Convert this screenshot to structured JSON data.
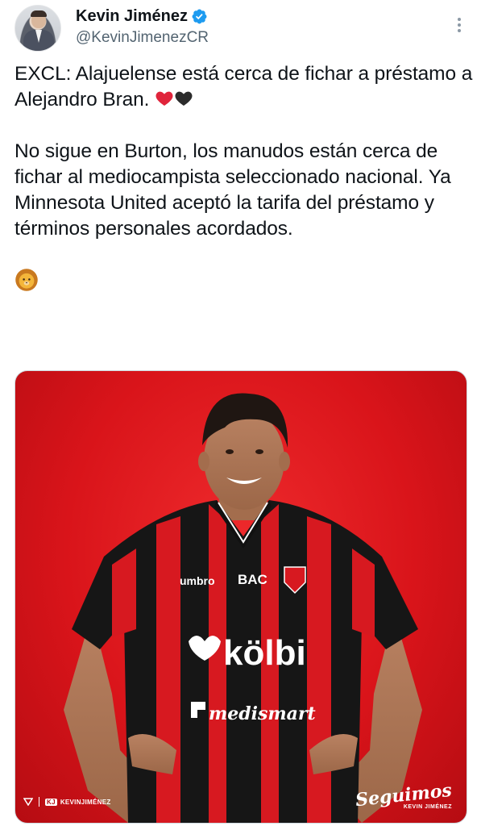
{
  "author": {
    "display_name": "Kevin Jiménez",
    "handle": "@KevinJimenezCR",
    "verified": true,
    "verified_color": "#1d9bf0"
  },
  "tweet": {
    "paragraph_1": "EXCL: Alajuelense está cerca de fichar a préstamo a Alejandro Bran.",
    "paragraph_1_emojis": [
      "red-heart-emoji",
      "black-heart-emoji"
    ],
    "paragraph_2": "No sigue en Burton, los manudos están cerca de fichar al mediocampista seleccionado nacional. Ya Minnesota United aceptó la tarifa del préstamo y términos personales acordados.",
    "paragraph_3_emoji": "lion-face-emoji"
  },
  "media": {
    "background_color": "#e11b22",
    "jersey_sponsor_main": "kölbi",
    "jersey_sponsor_small": "BAC",
    "jersey_brand": "umbro",
    "jersey_sponsor_lower": "medismart",
    "watermark_left": "KEVINJIMÉNEZ",
    "watermark_right_script": "Seguimos",
    "watermark_right_small": "KEVIN JIMÉNEZ"
  }
}
